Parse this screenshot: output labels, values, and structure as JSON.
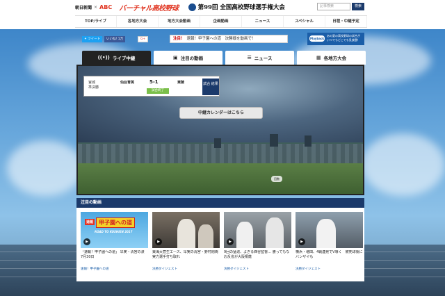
{
  "header": {
    "logo_asahi": "朝日新聞",
    "logo_x": "×",
    "logo_abc": "ABC",
    "logo_virtual": "バーチャル高校野球",
    "tournament_title": "第99回 全国高校野球選手権大会",
    "search_placeholder": "記事検索",
    "search_button": "検索"
  },
  "nav": {
    "items": [
      "TOP/ライブ",
      "各地方大会",
      "地方大会動画",
      "企画動画",
      "ニュース",
      "スペシャル",
      "日程・中継予定"
    ]
  },
  "social": {
    "tweet": "ツイート",
    "like": "いいね! 1万",
    "gplus": "G+"
  },
  "notice": {
    "label": "注目！",
    "text": "速報！甲子園への道　決勝戦を動画で！"
  },
  "banner": {
    "logo": "Playback",
    "text": "あの夏の高校野球の試合が いつでもどこでも見放題！"
  },
  "tabs": [
    {
      "label": "ライブ中継",
      "icon": "broadcast-icon",
      "active": true
    },
    {
      "label": "注目の動画",
      "icon": "video-icon",
      "active": false
    },
    {
      "label": "ニュース",
      "icon": "news-icon",
      "active": false
    },
    {
      "label": "各地方大会",
      "icon": "calendar-icon",
      "active": false
    }
  ],
  "live": {
    "pref": "宮城",
    "round": "準決勝",
    "team1": "仙台育英",
    "score": "5-1",
    "team2": "東陵",
    "status": "試合終了",
    "result_button": "試合 結果",
    "calendar_button": "中継カレンダーはこちら",
    "replay_label": "回数"
  },
  "featured": {
    "header": "注目の動画",
    "cards": [
      {
        "thumb_a": "速報",
        "thumb_b": "甲子園への道",
        "thumb_c": "ROAD TO KOSHIEN 2017",
        "title": "「速報！甲子園への道」 早実・清宮の涙　7月30日",
        "category": "速報！甲子園への道"
      },
      {
        "title": "東海大菅生エース、早実の清宮・野村剛両実力選手打ち取れ",
        "category": "決勝ダイジェスト"
      },
      {
        "title": "9回の猛追、よぎる西谷監督… 勝ってもなお反省が大阪桐蔭",
        "category": "決勝ダイジェスト"
      },
      {
        "title": "横浜・増田、4戦連発でV導く　被死球後にバンザイも",
        "category": "決勝ダイジェスト"
      }
    ]
  }
}
